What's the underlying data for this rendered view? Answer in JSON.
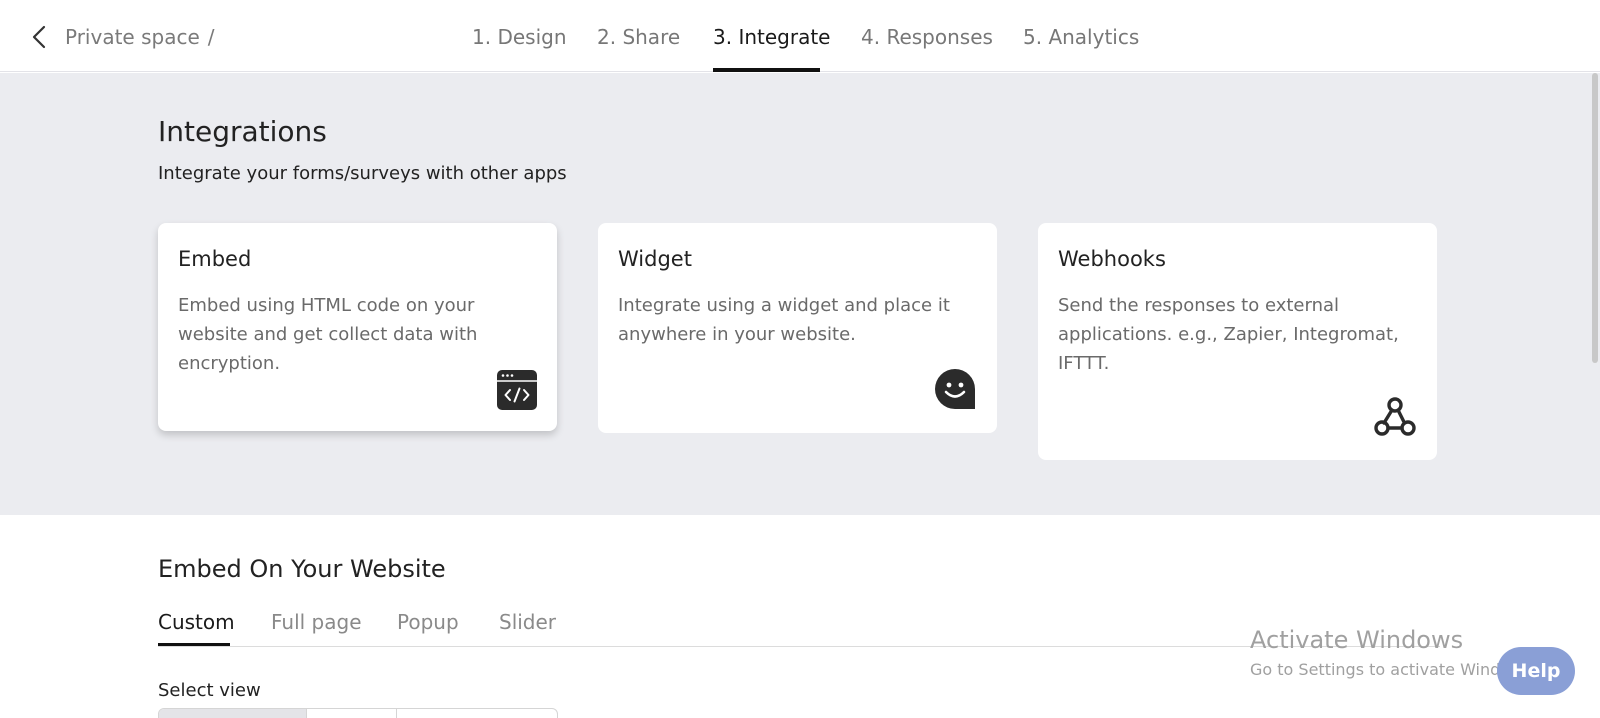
{
  "header": {
    "breadcrumb": "Private space",
    "separator": "/",
    "steps": [
      {
        "label": "1. Design"
      },
      {
        "label": "2. Share"
      },
      {
        "label": "3. Integrate"
      },
      {
        "label": "4. Responses"
      },
      {
        "label": "5. Analytics"
      }
    ],
    "active_step": "3. Integrate"
  },
  "integrations": {
    "title": "Integrations",
    "subtitle": "Integrate your forms/surveys with other apps",
    "cards": [
      {
        "title": "Embed",
        "description": "Embed using HTML code on your website and get collect data with encryption.",
        "icon": "code-window-icon"
      },
      {
        "title": "Widget",
        "description": "Integrate using a widget and place it anywhere in your website.",
        "icon": "smiley-chat-icon"
      },
      {
        "title": "Webhooks",
        "description": "Send the responses to external applications. e.g., Zapier, Integromat, IFTTT.",
        "icon": "webhook-icon"
      }
    ]
  },
  "embed": {
    "title": "Embed On Your Website",
    "tabs": [
      {
        "label": "Custom"
      },
      {
        "label": "Full page"
      },
      {
        "label": "Popup"
      },
      {
        "label": "Slider"
      }
    ],
    "active_tab": "Custom",
    "select_view_label": "Select view"
  },
  "watermark": {
    "title": "Activate Windows",
    "subtitle": "Go to Settings to activate Windo..."
  },
  "help_button": "Help",
  "colors": {
    "accent": "#111111",
    "integrations_bg": "#ebecf0",
    "help_bg": "#8a9fd6",
    "icon_dark": "#2b2b2b"
  }
}
